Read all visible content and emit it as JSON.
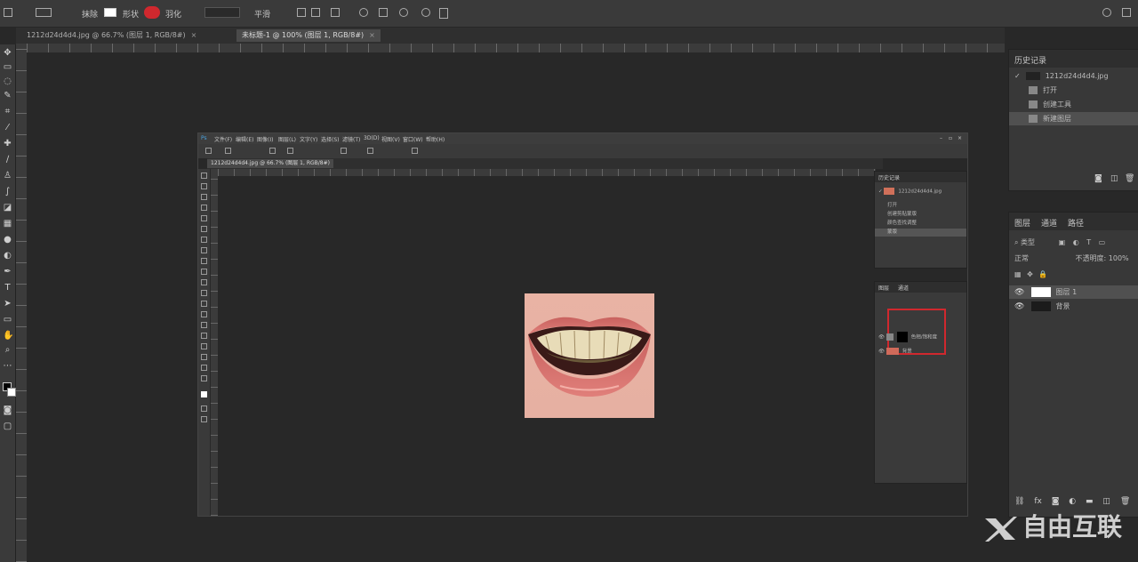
{
  "options_bar": {
    "mode_label": "模式",
    "erase_label": "抹除",
    "shape_label": "形状",
    "feather_label": "羽化",
    "smooth_label": "平滑"
  },
  "document_tabs": [
    {
      "label": "1212d24d4d4.jpg @ 66.7% (图层 1, RGB/8#)",
      "active": false
    },
    {
      "label": "未标题-1 @ 100% (图层 1, RGB/8#)",
      "active": true
    }
  ],
  "history_panel": {
    "title": "历史记录",
    "snapshot_label": "1212d24d4d4.jpg",
    "items": [
      {
        "label": "打开",
        "selected": false
      },
      {
        "label": "创建工具",
        "selected": false
      },
      {
        "label": "新建图层",
        "selected": true
      }
    ]
  },
  "layers_panel": {
    "tabs": [
      "图层",
      "通道",
      "路径"
    ],
    "filter_label": "类型",
    "blend_mode": "正常",
    "opacity_label": "不透明度: 100%",
    "layers": [
      {
        "name": "图层 1",
        "visible": true,
        "selected": true
      },
      {
        "name": "背景",
        "visible": true,
        "selected": false
      }
    ]
  },
  "inner_screenshot": {
    "menu_items": [
      "文件(F)",
      "编辑(E)",
      "图像(I)",
      "图层(L)",
      "文字(Y)",
      "选择(S)",
      "滤镜(T)",
      "3D(D)",
      "视图(V)",
      "窗口(W)",
      "帮助(H)"
    ],
    "tab_label": "1212d24d4d4.jpg @ 66.7% (图层 1, RGB/8#)",
    "history_title": "历史记录",
    "history_snapshot": "1212d24d4d4.jpg",
    "history_items": [
      "打开",
      "创建剪贴蒙版",
      "颜色查找调整",
      "蒙版"
    ],
    "layer_tabs": [
      "图层",
      "通道"
    ],
    "layers": [
      {
        "name": "色相/饱和度"
      },
      {
        "name": "背景"
      }
    ]
  },
  "watermark": {
    "text": "自由互联"
  },
  "colors": {
    "highlight_red": "#d0282e",
    "canvas_bg": "#282828",
    "panel_bg": "#383838"
  }
}
